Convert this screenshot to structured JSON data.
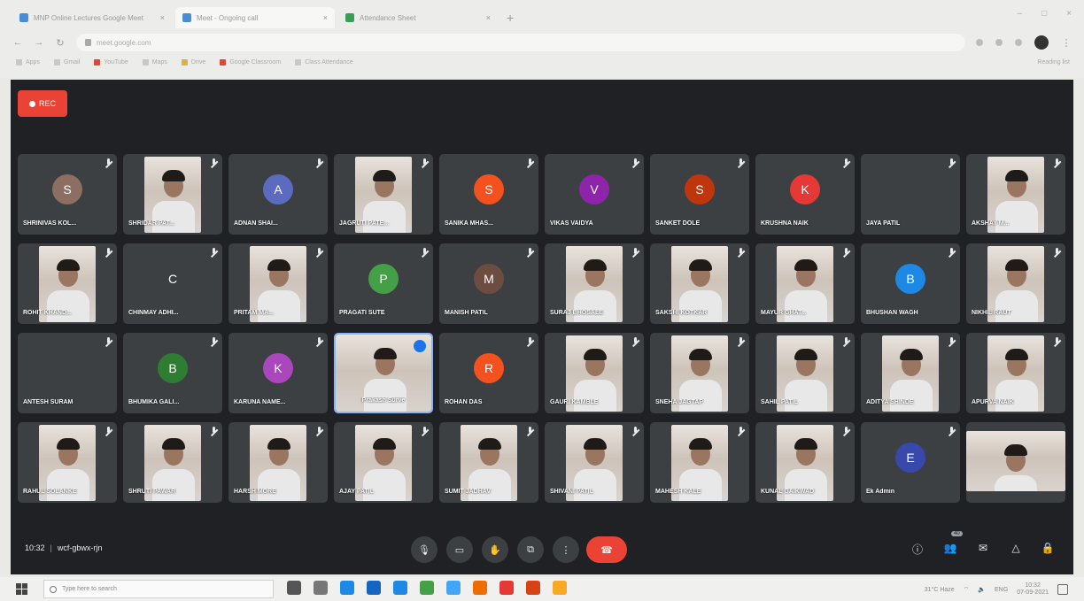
{
  "browser": {
    "tabs": [
      {
        "title": "MNP Online Lectures Google Meet",
        "state": "inactive",
        "icon": "meet-favicon"
      },
      {
        "title": "Meet - Ongoing call",
        "state": "active",
        "icon": "meet-favicon"
      },
      {
        "title": "Attendance Sheet",
        "state": "inactive",
        "icon": "sheets-favicon"
      }
    ],
    "new_tab": "+",
    "window_controls": [
      "–",
      "□",
      "×"
    ],
    "url": "meet.google.com",
    "bookmarks": [
      {
        "label": "Apps",
        "icon": "apps-icon"
      },
      {
        "label": "Gmail",
        "icon": "gmail-icon"
      },
      {
        "label": "YouTube",
        "icon": "youtube-icon"
      },
      {
        "label": "Maps",
        "icon": "maps-icon"
      },
      {
        "label": "Drive",
        "icon": "drive-icon"
      },
      {
        "label": "Google Classroom",
        "icon": "classroom-icon"
      },
      {
        "label": "Class Attendance",
        "icon": "bookmark-icon"
      }
    ],
    "reading_list": "Reading list"
  },
  "meet": {
    "rec_label": "REC",
    "participants": [
      {
        "name": "SHRINIVAS KOL...",
        "tile": "avatar",
        "letter": "S",
        "color": "#8d6e63"
      },
      {
        "name": "SHRIDAR PAT...",
        "tile": "video"
      },
      {
        "name": "ADNAN SHAI...",
        "tile": "avatar",
        "letter": "A",
        "color": "#5c6bc0"
      },
      {
        "name": "JAGRUTI PATE...",
        "tile": "video"
      },
      {
        "name": "SANIKA MHAS...",
        "tile": "avatar",
        "letter": "S",
        "color": "#f4511e"
      },
      {
        "name": "VIKAS VAIDYA",
        "tile": "avatar",
        "letter": "V",
        "color": "#8e24aa"
      },
      {
        "name": "SANKET DOLE",
        "tile": "avatar",
        "letter": "S",
        "color": "#bf360c"
      },
      {
        "name": "KRUSHNA NAIK",
        "tile": "avatar",
        "letter": "K",
        "color": "#e53935"
      },
      {
        "name": "JAYA PATIL",
        "tile": "blank"
      },
      {
        "name": "AKSHAY M...",
        "tile": "video"
      },
      {
        "name": "ROHIT KHAND...",
        "tile": "video"
      },
      {
        "name": "CHINMAY ADHI...",
        "tile": "avatar",
        "letter": "C",
        "color": "#3c4043"
      },
      {
        "name": "PRITAM MA...",
        "tile": "video"
      },
      {
        "name": "PRAGATI SUTE",
        "tile": "avatar",
        "letter": "P",
        "color": "#43a047"
      },
      {
        "name": "MANISH PATIL",
        "tile": "avatar",
        "letter": "M",
        "color": "#6d4c41"
      },
      {
        "name": "SURAJ BHOSALE",
        "tile": "video"
      },
      {
        "name": "SAKSHI KOTKAR",
        "tile": "video"
      },
      {
        "name": "MAYUR GHAT...",
        "tile": "video"
      },
      {
        "name": "BHUSHAN WAGH",
        "tile": "avatar",
        "letter": "B",
        "color": "#1e88e5"
      },
      {
        "name": "NIKHIL RAUT",
        "tile": "video"
      },
      {
        "name": "ANTESH SURAM",
        "tile": "blank"
      },
      {
        "name": "BHUMIKA GALI...",
        "tile": "avatar",
        "letter": "B",
        "color": "#2e7d32"
      },
      {
        "name": "KARUNA NAME...",
        "tile": "avatar",
        "letter": "K",
        "color": "#ab47bc"
      },
      {
        "name": "Prakash Surve",
        "tile": "video",
        "speaking": true
      },
      {
        "name": "ROHAN DAS",
        "tile": "avatar",
        "letter": "R",
        "color": "#f4511e"
      },
      {
        "name": "GAURI KAMBLE",
        "tile": "video"
      },
      {
        "name": "SNEHA JAGTAP",
        "tile": "video"
      },
      {
        "name": "SAHIL PATIL",
        "tile": "video"
      },
      {
        "name": "ADITYA SHINDE",
        "tile": "video"
      },
      {
        "name": "APURVA NAIK",
        "tile": "video"
      },
      {
        "name": "RAHUL SOLANKE",
        "tile": "video"
      },
      {
        "name": "SHRUTI PAWAR",
        "tile": "video"
      },
      {
        "name": "HARSH MORE",
        "tile": "video"
      },
      {
        "name": "AJAY PATIL",
        "tile": "video"
      },
      {
        "name": "SUMIT JADHAV",
        "tile": "video"
      },
      {
        "name": "SHIVANI PATIL",
        "tile": "video"
      },
      {
        "name": "MAHESH KALE",
        "tile": "video"
      },
      {
        "name": "KUNAL GAIKWAD",
        "tile": "video"
      },
      {
        "name": "Ek Admin",
        "tile": "avatar",
        "letter": "E",
        "color": "#3949ab"
      },
      {
        "name": "",
        "tile": "video-wide"
      }
    ]
  },
  "controls": {
    "time": "10:32",
    "meeting_code": "wcf-gbwx-rjn",
    "center": [
      {
        "name": "mic-button",
        "icon": "mic-icon",
        "glyph": "🎙"
      },
      {
        "name": "camera-button",
        "icon": "camera-icon",
        "glyph": "▭"
      },
      {
        "name": "raise-hand-button",
        "icon": "hand-icon",
        "glyph": "✋"
      },
      {
        "name": "present-button",
        "icon": "present-icon",
        "glyph": "⧉"
      },
      {
        "name": "more-options-button",
        "icon": "more-vertical-icon",
        "glyph": "⋮"
      },
      {
        "name": "end-call-button",
        "icon": "end-call-icon",
        "glyph": "☎",
        "end": true
      }
    ],
    "right": [
      {
        "name": "meeting-details-button",
        "icon": "info-icon",
        "glyph": "ⓘ"
      },
      {
        "name": "people-button",
        "icon": "people-icon",
        "glyph": "👥"
      },
      {
        "name": "chat-button",
        "icon": "chat-icon",
        "glyph": "✉"
      },
      {
        "name": "activities-button",
        "icon": "activities-icon",
        "glyph": "△"
      },
      {
        "name": "host-controls-button",
        "icon": "lock-icon",
        "glyph": "🔒"
      }
    ],
    "people_count": "40"
  },
  "taskbar": {
    "search_placeholder": "Type here to search",
    "apps": [
      {
        "icon": "cortana-icon",
        "color": "#555555"
      },
      {
        "icon": "task-view-icon",
        "color": "#777777"
      },
      {
        "icon": "edge-icon",
        "color": "#1e88e5"
      },
      {
        "icon": "store-icon",
        "color": "#1565c0"
      },
      {
        "icon": "mail-icon",
        "color": "#1e88e5"
      },
      {
        "icon": "chrome-icon",
        "color": "#43a047"
      },
      {
        "icon": "file-explorer-icon",
        "color": "#42a5f5"
      },
      {
        "icon": "app-icon",
        "color": "#ef6c00"
      },
      {
        "icon": "chrome-icon",
        "color": "#e53935"
      },
      {
        "icon": "chrome-icon",
        "color": "#d84315"
      },
      {
        "icon": "sticky-notes-icon",
        "color": "#f9a825"
      }
    ],
    "weather": "31°C Haze",
    "time": "10:32",
    "date": "07-09-2021",
    "lang": "ENG"
  }
}
